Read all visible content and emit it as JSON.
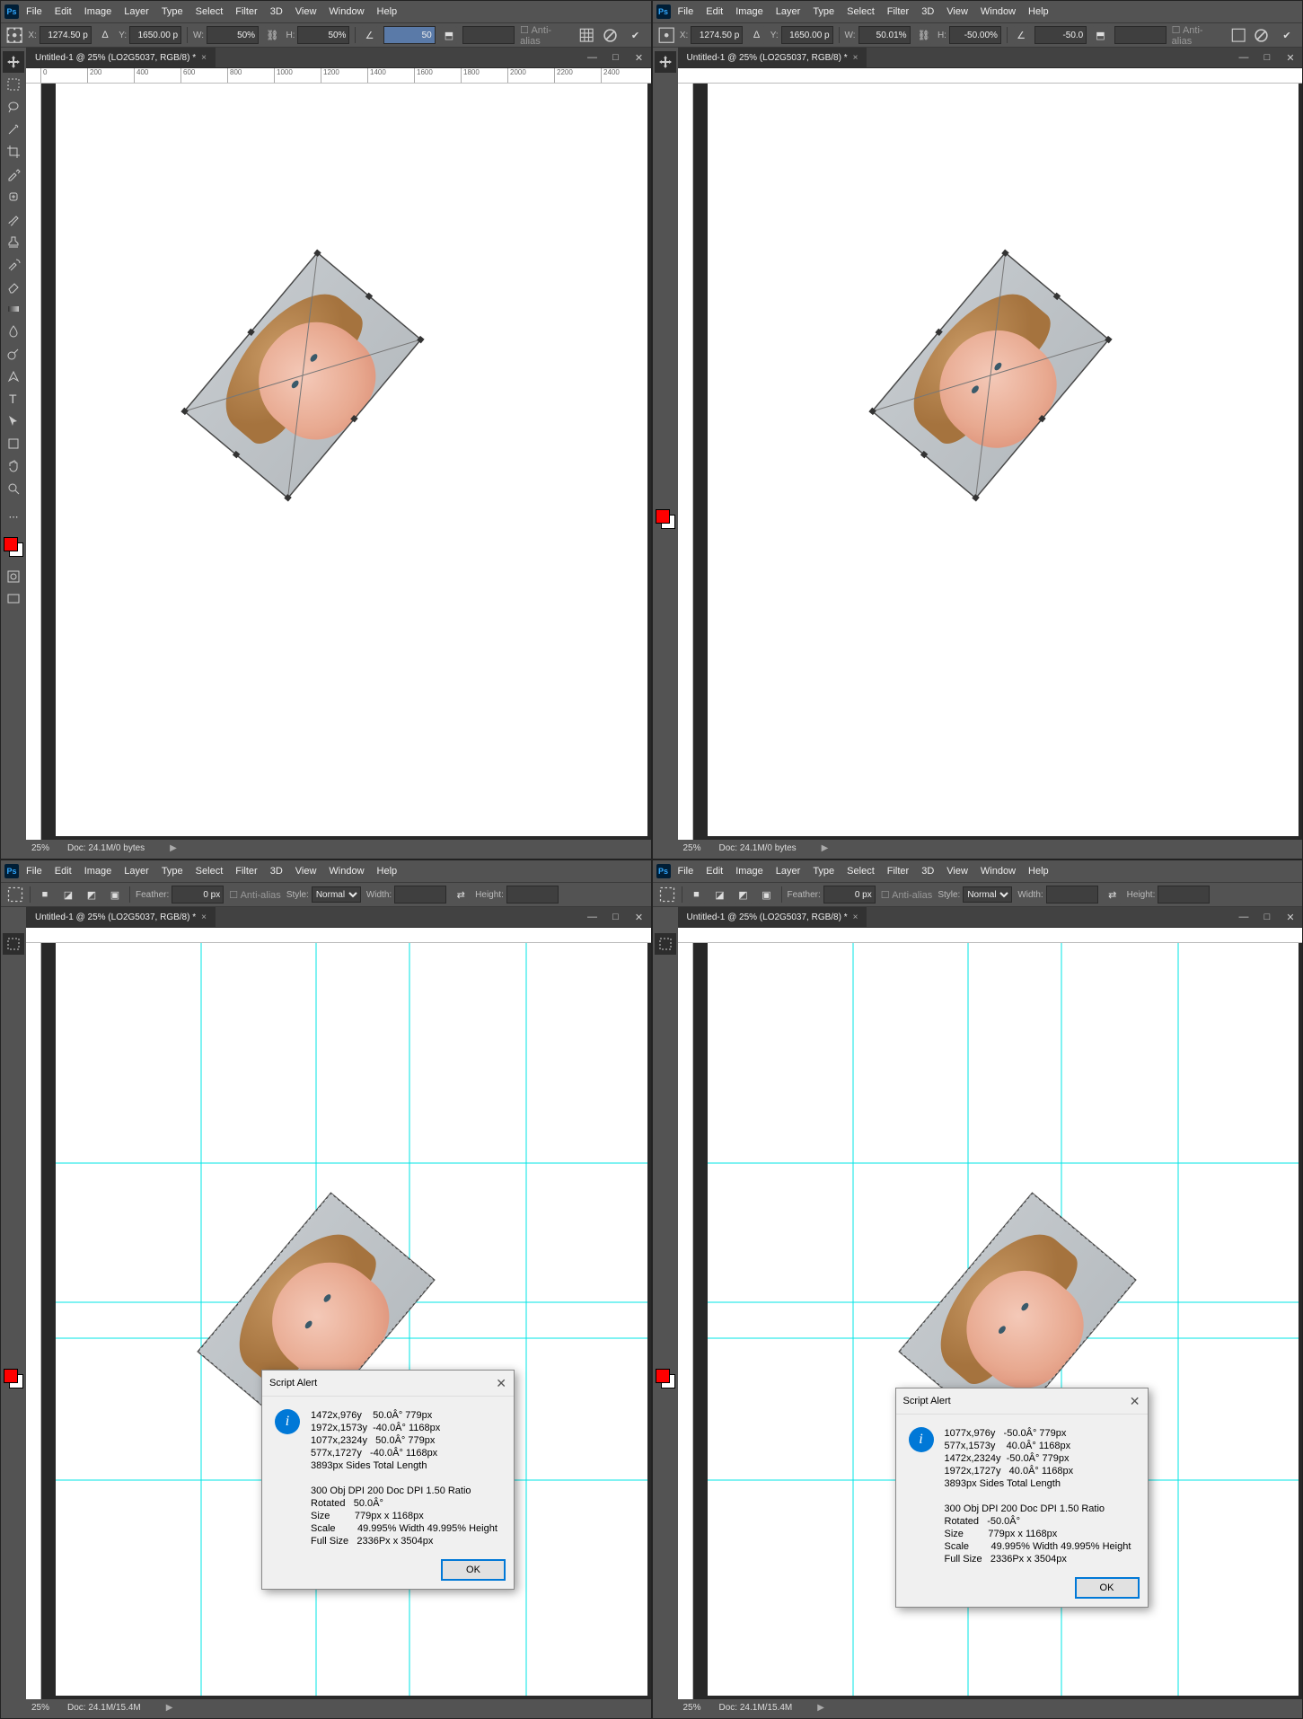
{
  "menu": [
    "File",
    "Edit",
    "Image",
    "Layer",
    "Type",
    "Select",
    "Filter",
    "3D",
    "View",
    "Window",
    "Help"
  ],
  "zooms": [
    "25%",
    "25%",
    "25%",
    "25%"
  ],
  "tab_title": "Untitled-1 @ 25% (LO2G5037, RGB/8) *",
  "status_doc": "Doc: 24.1M/0 bytes",
  "status_doc2": "Doc: 24.1M/15.4M",
  "status_zoom": "25%",
  "transform_bar": {
    "x": "1274.50 p",
    "y": "1650.00 p",
    "w": "50%",
    "h": "50%",
    "angle": "50",
    "skew": "",
    "aa": "Anti-alias"
  },
  "transform_bar2": {
    "x": "1274.50 p",
    "y": "1650.00 p",
    "w": "50.01%",
    "h": "-50.00%",
    "angle": "-50.0",
    "skew": "",
    "aa": "Anti-alias"
  },
  "marquee_bar": {
    "feather_lbl": "Feather:",
    "feather": "0 px",
    "aa": "Anti-alias",
    "style_lbl": "Style:",
    "style": "Normal",
    "w_lbl": "Width:",
    "h_lbl": "Height:"
  },
  "ruler_ticks": [
    "0",
    "200",
    "400",
    "600",
    "800",
    "1000",
    "1200",
    "1400",
    "1600",
    "1800",
    "2000",
    "2200",
    "2400"
  ],
  "dialog_title": "Script Alert",
  "dialog_ok": "OK",
  "alert1": "1472x,976y    50.0Â° 779px\n1972x,1573y  -40.0Â° 1168px\n1077x,2324y   50.0Â° 779px\n577x,1727y   -40.0Â° 1168px\n3893px Sides Total Length\n\n300 Obj DPI 200 Doc DPI 1.50 Ratio\nRotated   50.0Â°\nSize         779px x 1168px\nScale        49.995% Width 49.995% Height\nFull Size   2336Px x 3504px",
  "alert2": "1077x,976y   -50.0Â° 779px\n577x,1573y    40.0Â° 1168px\n1472x,2324y  -50.0Â° 779px\n1972x,1727y   40.0Â° 1168px\n3893px Sides Total Length\n\n300 Obj DPI 200 Doc DPI 1.50 Ratio\nRotated   -50.0Â°\nSize         779px x 1168px\nScale        49.995% Width 49.995% Height\nFull Size   2336Px x 3504px",
  "chart_data": null,
  "icons": {
    "refpoint": "reference-point-icon",
    "link": "link-icon",
    "cancel": "cancel-icon",
    "commit": "commit-icon",
    "interp": "interpolation-icon",
    "warp": "warp-icon"
  }
}
